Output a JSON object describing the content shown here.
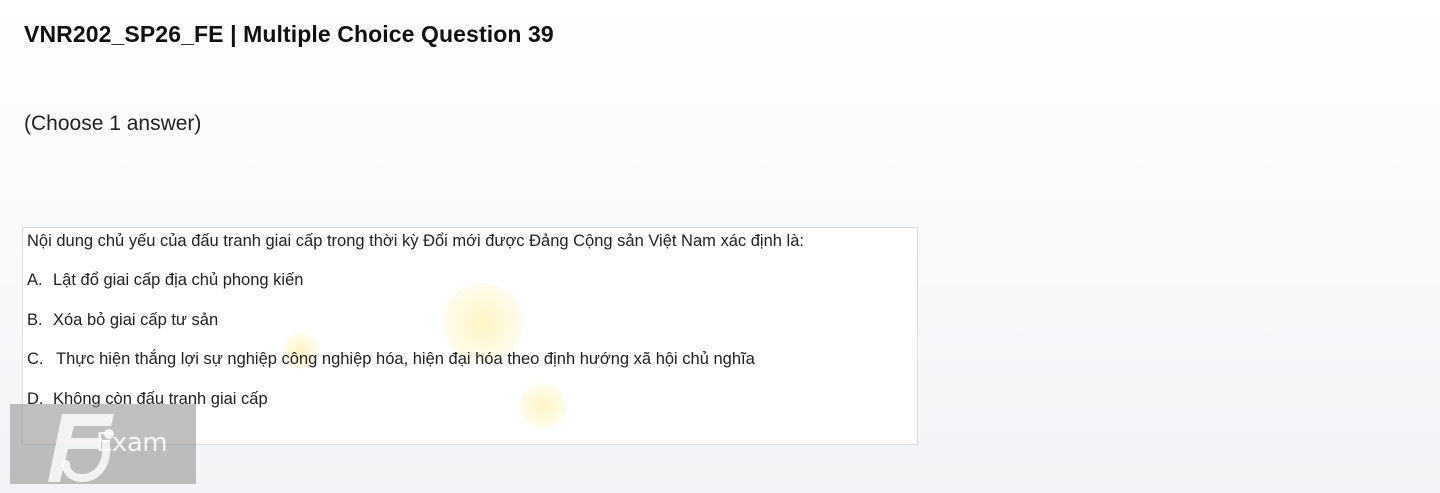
{
  "header": {
    "title": "VNR202_SP26_FE | Multiple Choice Question 39"
  },
  "instruction": "(Choose 1 answer)",
  "question": {
    "stem": "Nội dung chủ yếu của đấu tranh giai cấp trong thời kỳ Đổi mới được Đảng Cộng sản Việt Nam xác định là:",
    "options": [
      {
        "letter": "A.",
        "text": "Lật đổ giai cấp địa chủ phong kiến"
      },
      {
        "letter": "B.",
        "text": "Xóa bỏ giai cấp tư sản"
      },
      {
        "letter": "C.",
        "text": "Thực hiện thắng lợi sự nghiệp công nghiệp hóa, hiện đại hóa theo định hướng xã hội chủ nghĩa"
      },
      {
        "letter": "D.",
        "text": "Không còn đấu tranh giai cấp"
      }
    ]
  },
  "logo": {
    "text": "Exam"
  }
}
